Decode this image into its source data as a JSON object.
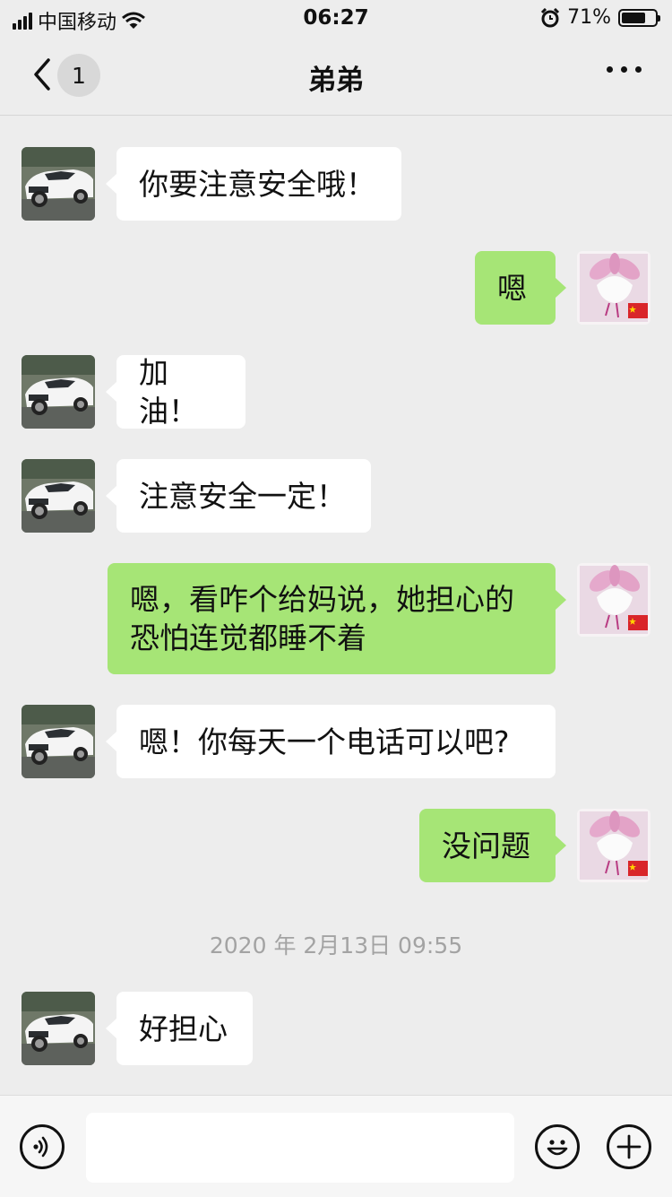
{
  "status_bar": {
    "carrier": "中国移动",
    "time": "06:27",
    "battery_percent": "71%",
    "battery_level": 0.71
  },
  "header": {
    "unread_count": "1",
    "title": "弟弟"
  },
  "messages": [
    {
      "from": "contact",
      "text": "你要注意安全哦！"
    },
    {
      "from": "me",
      "text": "嗯"
    },
    {
      "from": "contact",
      "text": "加油！"
    },
    {
      "from": "contact",
      "text": "注意安全一定！"
    },
    {
      "from": "me",
      "line1": "嗯，看咋个给妈说，她担心的",
      "line2": "恐怕连觉都睡不着"
    },
    {
      "from": "contact",
      "text": "嗯！你每天一个电话可以吧?"
    },
    {
      "from": "me",
      "text": "没问题"
    },
    {
      "from": "contact",
      "text": "好担心"
    }
  ],
  "timestamp": "2020 年 2月13日 09:55",
  "input": {
    "value": "",
    "placeholder": ""
  },
  "icons": {
    "back": "chevron-left-icon",
    "more": "more-dots-icon",
    "voice": "voice-icon",
    "emoji": "emoji-icon",
    "add": "plus-icon"
  },
  "colors": {
    "background": "#ededed",
    "incoming_bubble": "#ffffff",
    "outgoing_bubble": "#a6e576",
    "timestamp": "#a3a3a3"
  }
}
